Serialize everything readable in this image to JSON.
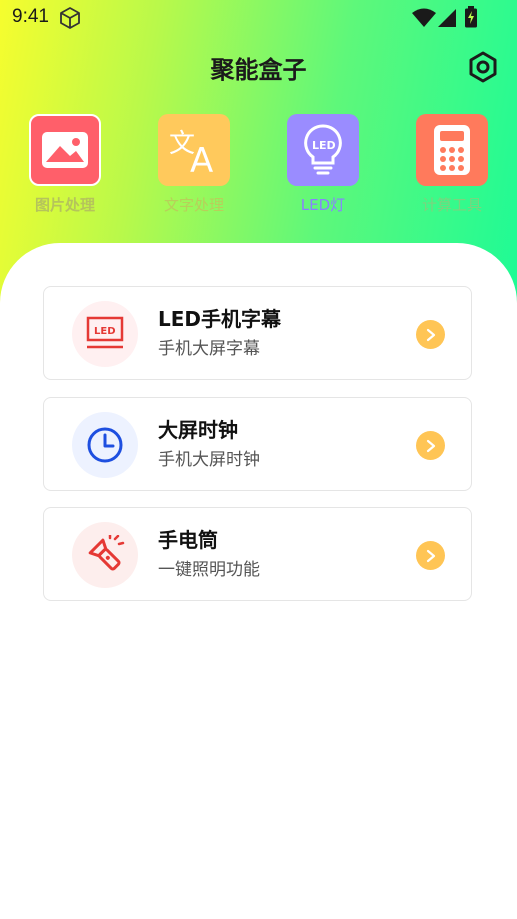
{
  "status_bar": {
    "time": "9:41"
  },
  "header": {
    "title": "聚能盒子"
  },
  "tools": [
    {
      "label": "图片处理",
      "color": "#b5c45b",
      "tile": "#ff5f6a"
    },
    {
      "label": "文字处理",
      "color": "#b8cf5a",
      "tile": "#ffc95c"
    },
    {
      "label": "LED灯",
      "color": "#8a80ff",
      "tile": "#9a8cff"
    },
    {
      "label": "计算工具",
      "color": "#7dd37e",
      "tile": "#ff7a5c"
    }
  ],
  "cards": [
    {
      "title": "LED手机字幕",
      "subtitle": "手机大屏字幕",
      "icon_bg": "#fff0f1",
      "icon_color": "#e53935"
    },
    {
      "title": "大屏时钟",
      "subtitle": "手机大屏时钟",
      "icon_bg": "#edf2ff",
      "icon_color": "#1e4fe0"
    },
    {
      "title": "手电筒",
      "subtitle": "一键照明功能",
      "icon_bg": "#fdeeed",
      "icon_color": "#e53935"
    }
  ],
  "colors": {
    "arrow_bg": "#ffc555"
  },
  "icons": [
    "cube-icon",
    "wifi-icon",
    "signal-icon",
    "battery-icon",
    "settings-icon",
    "image-icon",
    "translate-icon",
    "led-bulb-icon",
    "calculator-icon",
    "led-screen-icon",
    "clock-icon",
    "flashlight-icon",
    "chevron-right-icon"
  ]
}
